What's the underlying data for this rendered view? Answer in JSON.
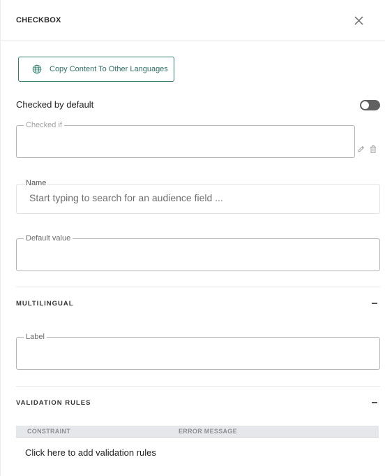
{
  "header": {
    "title": "CHECKBOX"
  },
  "copy_button": {
    "label": "Copy Content To Other Languages"
  },
  "checked_by_default": {
    "label": "Checked by default",
    "toggle_on": false
  },
  "checked_if": {
    "legend": "Checked if",
    "value": ""
  },
  "name": {
    "label": "Name",
    "placeholder": "Start typing to search for an audience field ..."
  },
  "default_value": {
    "legend": "Default value",
    "value": ""
  },
  "multilingual": {
    "title": "MULTILINGUAL",
    "label_field": {
      "legend": "Label",
      "value": ""
    }
  },
  "validation": {
    "title": "VALIDATION RULES",
    "columns": [
      "CONSTRAINT",
      "ERROR MESSAGE"
    ],
    "add_text": "Click here to add validation rules"
  },
  "colors": {
    "accent": "#2e7d6b",
    "toggle_off": "#616161",
    "table_header": "#e6e7ea"
  },
  "icons": {
    "close": "close-icon",
    "globe": "globe-icon",
    "edit": "pencil-icon",
    "delete": "trash-icon",
    "collapse": "minus-icon"
  }
}
